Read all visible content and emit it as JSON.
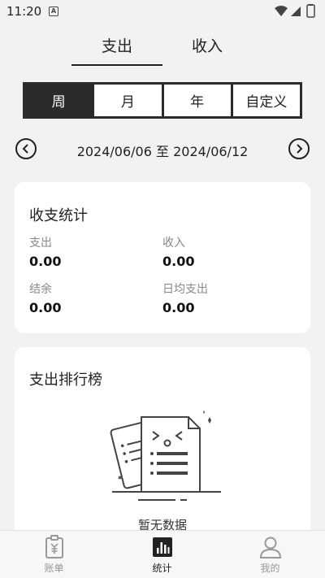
{
  "status_bar": {
    "time": "11:20"
  },
  "top_tabs": [
    {
      "label": "支出",
      "active": true
    },
    {
      "label": "收入",
      "active": false
    }
  ],
  "period": [
    {
      "label": "周",
      "active": true
    },
    {
      "label": "月",
      "active": false
    },
    {
      "label": "年",
      "active": false
    },
    {
      "label": "自定义",
      "active": false
    }
  ],
  "range": {
    "text": "2024/06/06 至 2024/06/12"
  },
  "summary": {
    "title": "收支统计",
    "expense_label": "支出",
    "expense_value": "0.00",
    "income_label": "收入",
    "income_value": "0.00",
    "balance_label": "结余",
    "balance_value": "0.00",
    "daily_label": "日均支出",
    "daily_value": "0.00"
  },
  "ranking": {
    "title": "支出排行榜",
    "empty_text": "暂无数据"
  },
  "bottom_nav": [
    {
      "label": "账单",
      "icon": "bill-icon",
      "active": false
    },
    {
      "label": "统计",
      "icon": "chart-icon",
      "active": true
    },
    {
      "label": "我的",
      "icon": "profile-icon",
      "active": false
    }
  ],
  "colors": {
    "dark": "#2b2b2b",
    "background": "#f2f2f2",
    "muted": "#999999"
  }
}
